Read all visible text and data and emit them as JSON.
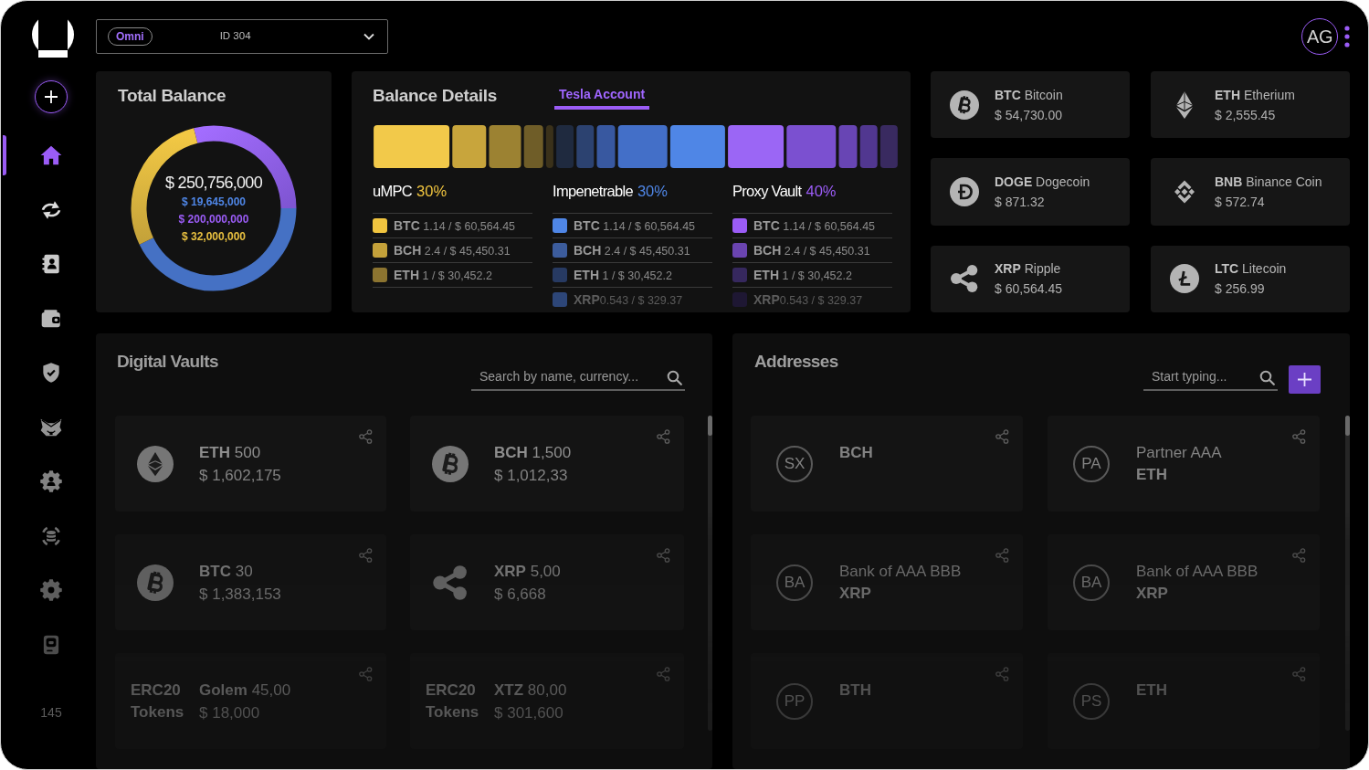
{
  "sidebar": {
    "items": [
      {
        "kind": "home",
        "selected": true
      },
      {
        "kind": "transfer",
        "selected": false
      },
      {
        "kind": "contacts",
        "selected": false
      },
      {
        "kind": "wallet",
        "selected": false
      },
      {
        "kind": "shield",
        "selected": false
      },
      {
        "kind": "fox",
        "selected": false
      },
      {
        "kind": "user-gear",
        "selected": false
      },
      {
        "kind": "database",
        "selected": false
      },
      {
        "kind": "gear",
        "selected": false
      },
      {
        "kind": "drive",
        "selected": false
      }
    ],
    "footer": "145"
  },
  "top_bar": {
    "account_select": {
      "tag": "Omni",
      "value": "ID 304"
    },
    "user": {
      "initials": "AG"
    }
  },
  "total_balance": {
    "title": "Total Balance",
    "total": "$ 250,756,000",
    "amounts": [
      {
        "text": "$ 19,645,000",
        "color": "#4f86e6"
      },
      {
        "text": "$ 200,000,000",
        "color": "#9b5cf6"
      },
      {
        "text": "$ 32,000,000",
        "color": "#e8c040"
      }
    ]
  },
  "balance_details": {
    "title": "Balance Details",
    "tabs": [
      {
        "label": "Tesla Account",
        "selected": true
      }
    ],
    "groups": [
      {
        "name": "uMPC",
        "share": "30%",
        "color": "#f0c43f",
        "rows": [
          {
            "text": "**BTC** 1.14 / $ 60,564.45",
            "color": "#f0c43f"
          },
          {
            "text": "**BCH** 2.4 / $ 45,450.31",
            "color": "#c4a13a"
          },
          {
            "text": "**ETH** 1 / $ 30,452.2",
            "color": "#8c7430"
          }
        ]
      },
      {
        "name": "Impenetrable",
        "share": "30%",
        "color": "#4f86e6",
        "rows": [
          {
            "text": "**BTC** 1.14 / $ 60,564.45",
            "color": "#4f86e6"
          },
          {
            "text": "**BCH** 2.4 / $ 45,450.31",
            "color": "#3c5c9c"
          },
          {
            "text": "**ETH** 1 / $ 30,452.2",
            "color": "#273a62"
          },
          {
            "text": "**XRP**0.543 / $ 329.37",
            "color": "#2d4678"
          }
        ]
      },
      {
        "name": "Proxy Vault",
        "share": "40%",
        "color": "#9b5cf6",
        "rows": [
          {
            "text": "**BTC** 1.14 / $ 60,564.45",
            "color": "#9b5cf6"
          },
          {
            "text": "**BCH** 2.4 / $ 45,450.31",
            "color": "#6a44b0"
          },
          {
            "text": "**ETH** 1 / $ 30,452.2",
            "color": "#36285e"
          },
          {
            "text": "**XRP**0.543 / $ 329.37",
            "color": "#1e1733"
          }
        ]
      }
    ]
  },
  "coins": [
    {
      "kind": "bitcoin",
      "text": "**BTC** Bitcoin",
      "price": "$ 54,730.00"
    },
    {
      "kind": "ethereum",
      "text": "**ETH** Etherium",
      "price": "$ 2,555.45"
    },
    {
      "kind": "doge",
      "text": "**DOGE** Dogecoin",
      "price": "$ 871.32"
    },
    {
      "kind": "bnb",
      "text": "**BNB** Binance Coin",
      "price": "$ 572.74"
    },
    {
      "kind": "xrp",
      "text": "**XRP** Ripple",
      "price": "$ 60,564.45"
    },
    {
      "kind": "litecoin",
      "text": "**LTC** Litecoin",
      "price": "$ 256.99"
    }
  ],
  "digital_vaults": {
    "title": "Digital Vaults",
    "search": {
      "placeholder": "Search by name, currency..."
    },
    "items": [
      {
        "kind": "ethereum",
        "text": "**ETH** 500",
        "value": "$ 1,602,175"
      },
      {
        "kind": "bitcoin",
        "text": "**BCH** 1,500",
        "value": "$ 1,012,33"
      },
      {
        "kind": "bitcoin",
        "text": "**BTC** 30",
        "value": "$ 1,383,153"
      },
      {
        "kind": "xrp",
        "text": "**XRP** 5,00",
        "value": "$ 6,668"
      },
      {
        "kind": "token",
        "badge": "ERC20 Tokens",
        "text": "**Golem** 45,00",
        "value": "$ 18,000"
      },
      {
        "kind": "token",
        "badge": "ERC20 Tokens",
        "text": "**XTZ** 80,00",
        "value": "$ 301,600"
      }
    ]
  },
  "addresses": {
    "title": "Addresses",
    "search": {
      "placeholder": "Start typing..."
    },
    "items": [
      {
        "initials": "SX",
        "currency": "BCH"
      },
      {
        "initials": "PA",
        "name": "Partner AAA",
        "currency": "ETH"
      },
      {
        "initials": "BA",
        "name": "Bank of AAA BBB",
        "currency": "XRP"
      },
      {
        "initials": "BA",
        "name": "Bank of AAA BBB",
        "currency": "XRP"
      },
      {
        "initials": "PP",
        "currency": "BTH"
      },
      {
        "initials": "PS",
        "currency": "ETH"
      }
    ]
  }
}
